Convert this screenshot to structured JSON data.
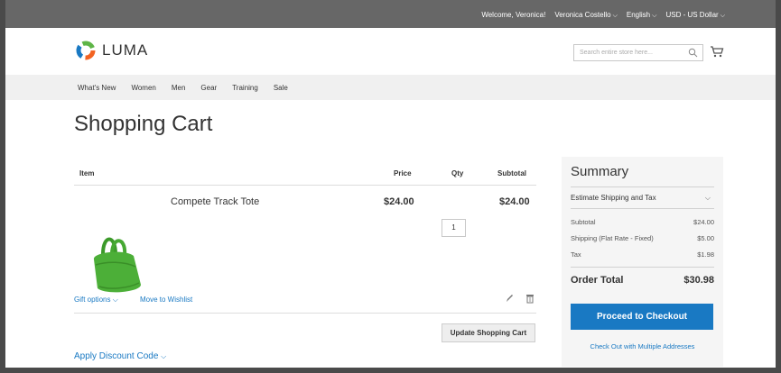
{
  "topbar": {
    "welcome": "Welcome, Veronica!",
    "account": "Veronica Costello",
    "language": "English",
    "currency": "USD - US Dollar"
  },
  "header": {
    "logo_text": "LUMA",
    "search_placeholder": "Search entire store here...",
    "brand_colors": {
      "orange": "#f26322",
      "blue": "#1979c3",
      "green": "#5eb547"
    }
  },
  "nav": {
    "items": [
      "What's New",
      "Women",
      "Men",
      "Gear",
      "Training",
      "Sale"
    ]
  },
  "page_title": "Shopping Cart",
  "cart": {
    "columns": {
      "item": "Item",
      "price": "Price",
      "qty": "Qty",
      "subtotal": "Subtotal"
    },
    "items": [
      {
        "name": "Compete Track Tote",
        "price": "$24.00",
        "qty": "1",
        "subtotal": "$24.00"
      }
    ],
    "gift_options": "Gift options",
    "move_to_wishlist": "Move to Wishlist",
    "update_label": "Update Shopping Cart",
    "discount_label": "Apply Discount Code"
  },
  "summary": {
    "title": "Summary",
    "estimate_label": "Estimate Shipping and Tax",
    "lines": [
      {
        "label": "Subtotal",
        "value": "$24.00"
      },
      {
        "label": "Shipping (Flat Rate - Fixed)",
        "value": "$5.00"
      },
      {
        "label": "Tax",
        "value": "$1.98"
      }
    ],
    "total_label": "Order Total",
    "total_value": "$30.98",
    "checkout_label": "Proceed to Checkout",
    "multi_label": "Check Out with Multiple Addresses"
  }
}
